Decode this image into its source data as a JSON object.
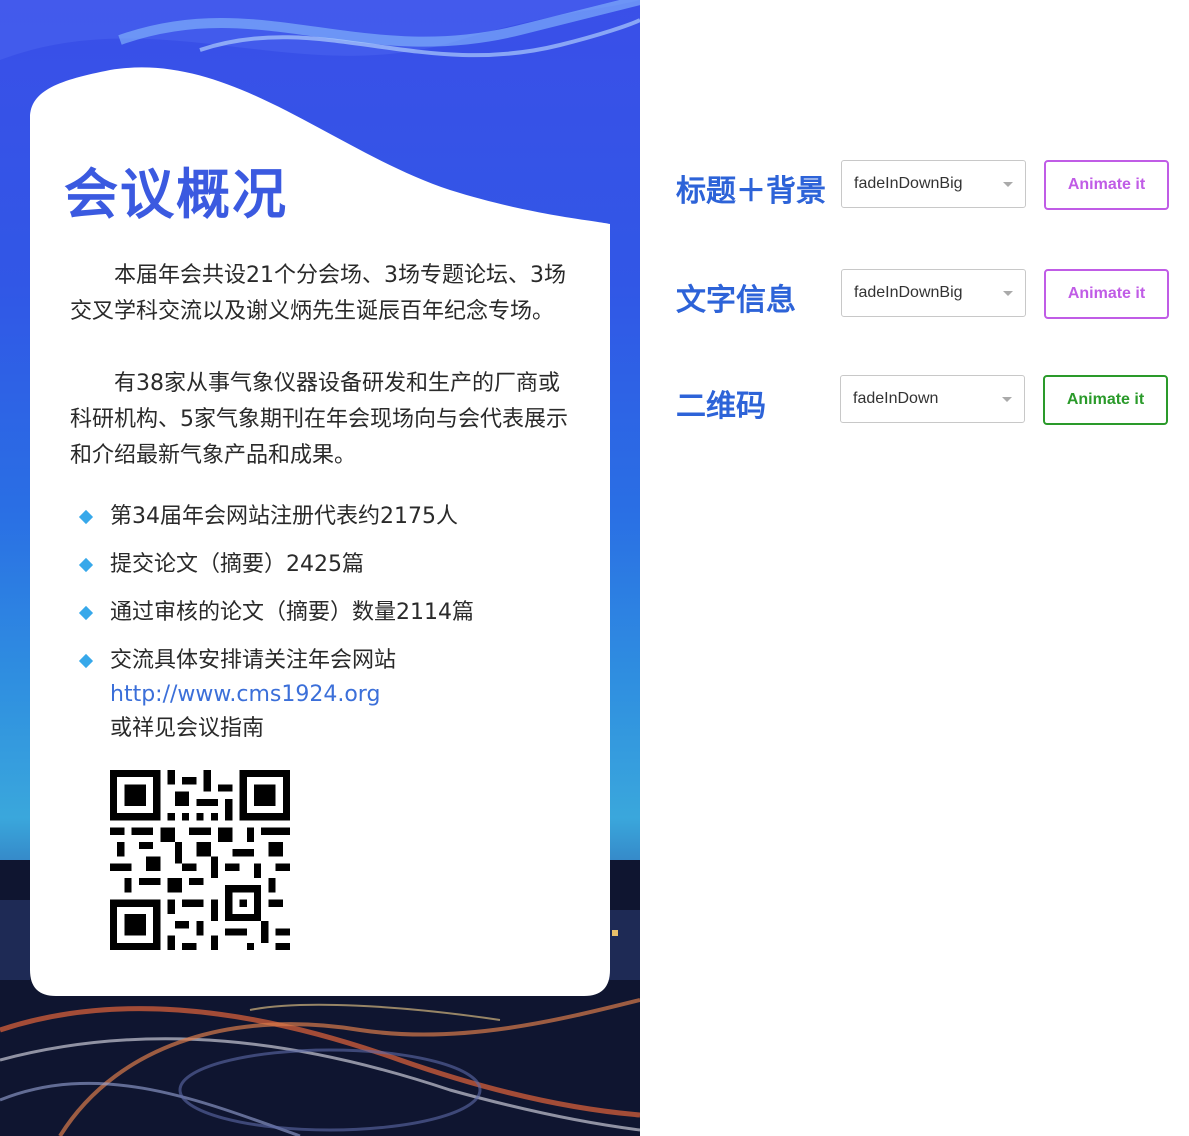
{
  "poster": {
    "title": "会议概况",
    "paragraphs": [
      "本届年会共设21个分会场、3场专题论坛、3场交叉学科交流以及谢义炳先生诞辰百年纪念专场。",
      "有38家从事气象仪器设备研发和生产的厂商或科研机构、5家气象期刊在年会现场向与会代表展示和介绍最新气象产品和成果。"
    ],
    "bullets": [
      "第34届年会网站注册代表约2175人",
      "提交论文（摘要）2425篇",
      "通过审核的论文（摘要）数量2114篇",
      "交流具体安排请关注年会网站"
    ],
    "link": "http://www.cms1924.org",
    "link_suffix": "或祥见会议指南",
    "colors": {
      "title": "#3b5ae0",
      "bullet": "#37a8ea",
      "link": "#3b6fd9"
    }
  },
  "controls": [
    {
      "label": "标题＋背景",
      "select_value": "fadeInDownBig",
      "button": "Animate it",
      "button_color": "#c05ce6"
    },
    {
      "label": "文字信息",
      "select_value": "fadeInDownBig",
      "button": "Animate it",
      "button_color": "#c05ce6"
    },
    {
      "label": "二维码",
      "select_value": "fadeInDown",
      "button": "Animate it",
      "button_color": "#2a9a2a"
    }
  ],
  "icons": {
    "bullet": "diamond-icon",
    "dropdown": "chevron-down-icon"
  }
}
